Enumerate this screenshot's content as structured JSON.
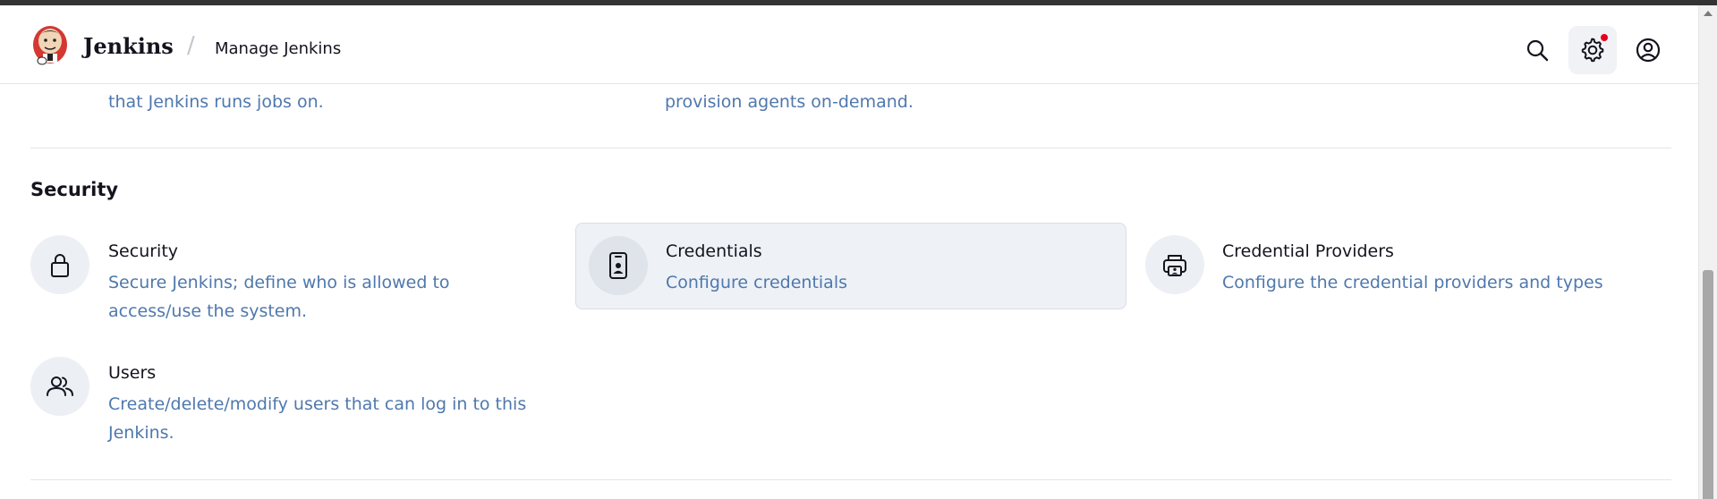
{
  "header": {
    "brand": "Jenkins",
    "breadcrumb_separator": "/",
    "breadcrumb_current": "Manage Jenkins",
    "settings_has_notification": true
  },
  "previous_section": {
    "left_desc_tail": "that Jenkins runs jobs on.",
    "right_desc_tail": "provision agents on-demand."
  },
  "security_section": {
    "title": "Security",
    "items": [
      {
        "title": "Security",
        "description": "Secure Jenkins; define who is allowed to access/use the system.",
        "icon": "lock-icon"
      },
      {
        "title": "Credentials",
        "description": "Configure credentials",
        "icon": "phone-id-icon"
      },
      {
        "title": "Credential Providers",
        "description": "Configure the credential providers and types",
        "icon": "printer-id-icon"
      },
      {
        "title": "Users",
        "description": "Create/delete/modify users that can log in to this Jenkins.",
        "icon": "users-icon"
      }
    ]
  },
  "colors": {
    "accent_text": "#4f78ad",
    "notification": "#e6001f",
    "hover_tile": "#eef1f6"
  }
}
